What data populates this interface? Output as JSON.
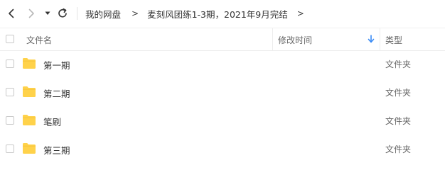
{
  "nav": {
    "back_icon": "chevron-left-icon",
    "forward_icon": "chevron-right-icon",
    "history_icon": "caret-down-icon",
    "refresh_icon": "refresh-icon"
  },
  "breadcrumb": {
    "root": "我的网盘",
    "separator": ">",
    "current": "麦刻风团练1-3期，2021年9月完结"
  },
  "header": {
    "name": "文件名",
    "modified": "修改时间",
    "type": "类型",
    "sort_icon": "sort-down-arrow-icon"
  },
  "files": [
    {
      "name": "第一期",
      "modified": "",
      "type": "文件夹",
      "icon": "folder-icon"
    },
    {
      "name": "第二期",
      "modified": "",
      "type": "文件夹",
      "icon": "folder-icon"
    },
    {
      "name": "笔刷",
      "modified": "",
      "type": "文件夹",
      "icon": "folder-icon"
    },
    {
      "name": "第三期",
      "modified": "",
      "type": "文件夹",
      "icon": "folder-icon"
    }
  ],
  "colors": {
    "folder": "#ffd24a",
    "sort_arrow": "#3a8bf5",
    "text": "#333333",
    "muted_text": "#666666"
  }
}
